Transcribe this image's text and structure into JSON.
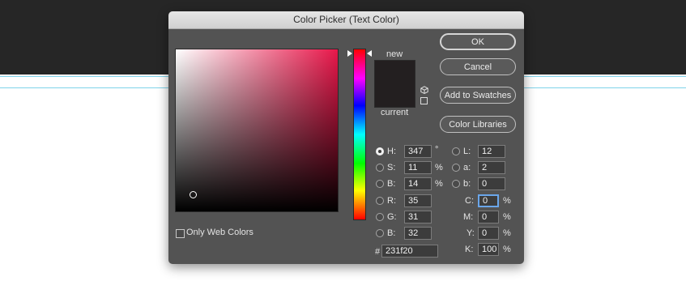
{
  "dialog": {
    "title": "Color Picker (Text Color)"
  },
  "only_web_colors_label": "Only Web Colors",
  "preview": {
    "new_label": "new",
    "current_label": "current",
    "color": "#231f20"
  },
  "buttons": {
    "ok": "OK",
    "cancel": "Cancel",
    "add_swatches": "Add to Swatches",
    "color_libraries": "Color Libraries"
  },
  "hsb": {
    "h": {
      "label": "H:",
      "value": "347",
      "unit": "°",
      "selected": true
    },
    "s": {
      "label": "S:",
      "value": "11",
      "unit": "%"
    },
    "b": {
      "label": "B:",
      "value": "14",
      "unit": "%"
    }
  },
  "rgb": {
    "r": {
      "label": "R:",
      "value": "35"
    },
    "g": {
      "label": "G:",
      "value": "31"
    },
    "b": {
      "label": "B:",
      "value": "32"
    }
  },
  "lab": {
    "l": {
      "label": "L:",
      "value": "12"
    },
    "a": {
      "label": "a:",
      "value": "2"
    },
    "b": {
      "label": "b:",
      "value": "0"
    }
  },
  "cmyk": {
    "c": {
      "label": "C:",
      "value": "0",
      "unit": "%"
    },
    "m": {
      "label": "M:",
      "value": "0",
      "unit": "%"
    },
    "y": {
      "label": "Y:",
      "value": "0",
      "unit": "%"
    },
    "k": {
      "label": "K:",
      "value": "100",
      "unit": "%"
    }
  },
  "hex": {
    "label": "#",
    "value": "231f20"
  },
  "colors": {
    "field_hue": "#e8174a",
    "accent_focus": "#6aa6ea",
    "guide_line": "#7fd3ea"
  }
}
